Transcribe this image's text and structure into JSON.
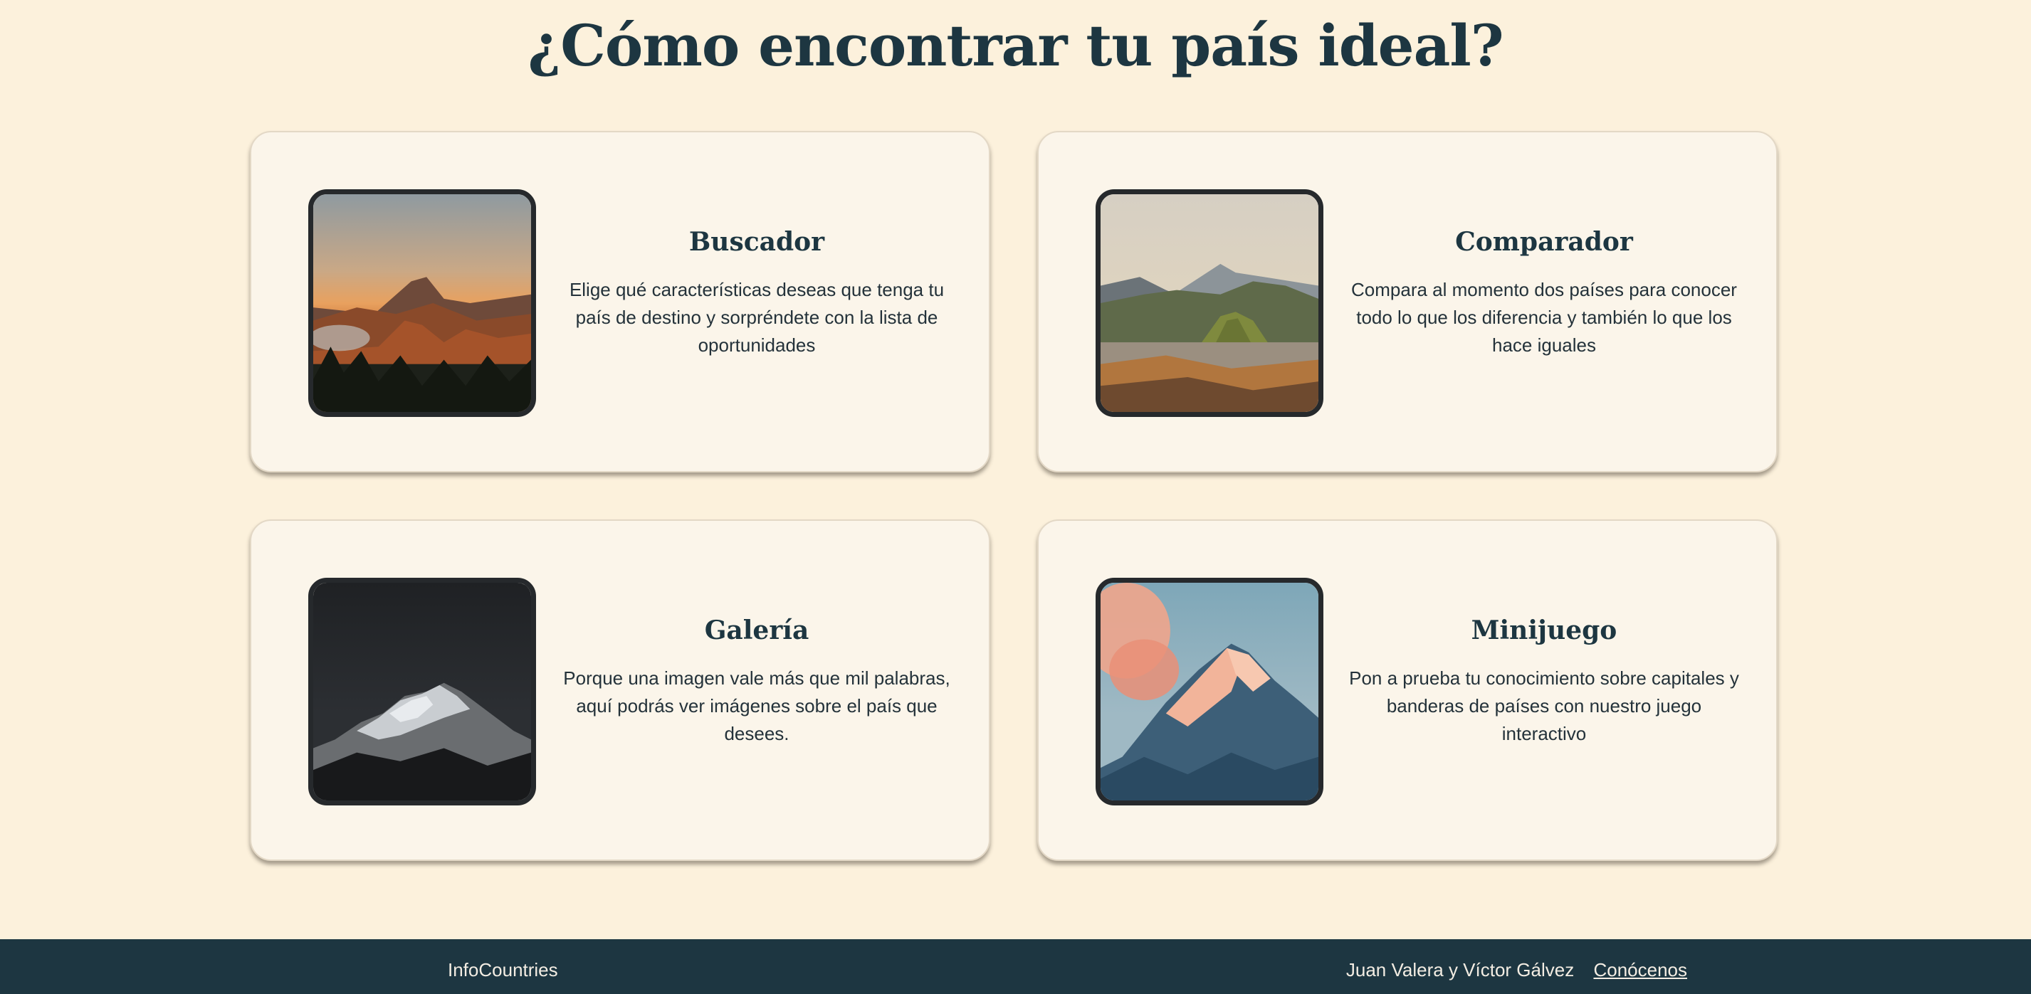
{
  "header": {
    "title": "¿Cómo encontrar tu país ideal?"
  },
  "cards": [
    {
      "title": "Buscador",
      "description": "Elige qué características deseas que tenga tu país de destino y sorpréndete con la lista de oportunidades",
      "image": "mountain-sunset-photo"
    },
    {
      "title": "Comparador",
      "description": "Compara al momento dos países para conocer todo lo que los diferencia y también lo que los hace iguales",
      "image": "volcano-valley-photo"
    },
    {
      "title": "Galería",
      "description": "Porque una imagen vale más que mil palabras, aquí podrás ver imágenes sobre el país que desees.",
      "image": "dark-snowy-peak-photo"
    },
    {
      "title": "Minijuego",
      "description": "Pon a prueba tu conocimiento sobre capitales y banderas de países con nuestro juego interactivo",
      "image": "pink-mountain-photo"
    }
  ],
  "footer": {
    "brand": "InfoCountries",
    "authors": "Juan Valera y Víctor Gálvez",
    "link_label": "Conócenos"
  },
  "colors": {
    "background": "#fcf1dc",
    "card": "#fbf5ea",
    "text": "#1d3641",
    "footer": "#1d3641"
  }
}
